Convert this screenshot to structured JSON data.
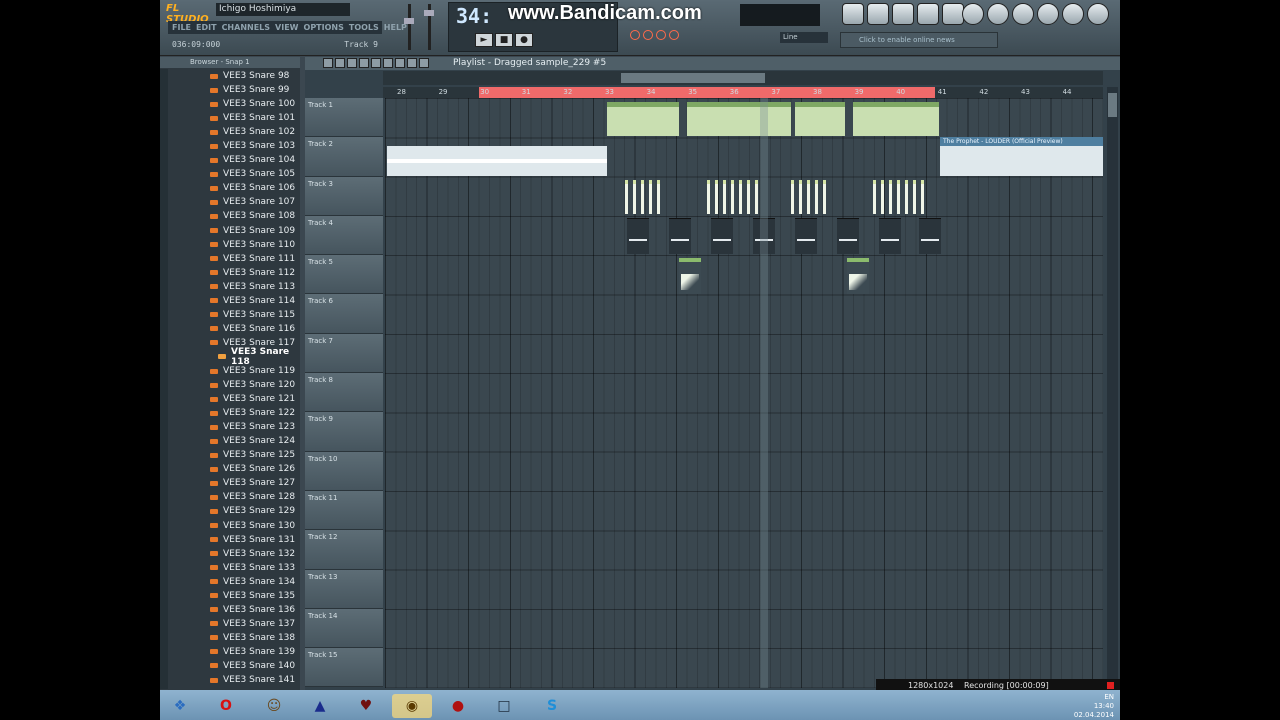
{
  "app": {
    "logo": "FL STUDIO",
    "song_title": "Ichigo Hoshimiya",
    "menus": [
      "FILE",
      "EDIT",
      "CHANNELS",
      "VIEW",
      "OPTIONS",
      "TOOLS",
      "HELP"
    ],
    "song_time": "036:09:000",
    "focus_label": "Track 9",
    "clock": "34:",
    "watermark": "www.Bandicam.com",
    "mode": "Line",
    "news": "Click to enable online news"
  },
  "browser": {
    "title": "Browser - Snap 1",
    "items": [
      "VEE3 Snare 98",
      "VEE3 Snare 99",
      "VEE3 Snare 100",
      "VEE3 Snare 101",
      "VEE3 Snare 102",
      "VEE3 Snare 103",
      "VEE3 Snare 104",
      "VEE3 Snare 105",
      "VEE3 Snare 106",
      "VEE3 Snare 107",
      "VEE3 Snare 108",
      "VEE3 Snare 109",
      "VEE3 Snare 110",
      "VEE3 Snare 111",
      "VEE3 Snare 112",
      "VEE3 Snare 113",
      "VEE3 Snare 114",
      "VEE3 Snare 115",
      "VEE3 Snare 116",
      "VEE3 Snare 117",
      "VEE3 Snare 118",
      "VEE3 Snare 119",
      "VEE3 Snare 120",
      "VEE3 Snare 121",
      "VEE3 Snare 122",
      "VEE3 Snare 123",
      "VEE3 Snare 124",
      "VEE3 Snare 125",
      "VEE3 Snare 126",
      "VEE3 Snare 127",
      "VEE3 Snare 128",
      "VEE3 Snare 129",
      "VEE3 Snare 130",
      "VEE3 Snare 131",
      "VEE3 Snare 132",
      "VEE3 Snare 133",
      "VEE3 Snare 134",
      "VEE3 Snare 135",
      "VEE3 Snare 136",
      "VEE3 Snare 137",
      "VEE3 Snare 138",
      "VEE3 Snare 139",
      "VEE3 Snare 140",
      "VEE3 Snare 141"
    ],
    "selected": "VEE3 Snare 118"
  },
  "playlist": {
    "title": "Playlist - Dragged sample_229 #5",
    "ruler": [
      "28",
      "29",
      "30",
      "31",
      "32",
      "33",
      "34",
      "35",
      "36",
      "37",
      "38",
      "39",
      "40",
      "41",
      "42",
      "43",
      "44"
    ],
    "tracks": [
      "Track 1",
      "Track 2",
      "Track 3",
      "Track 4",
      "Track 5",
      "Track 6",
      "Track 7",
      "Track 8",
      "Track 9",
      "Track 10",
      "Track 11",
      "Track 12",
      "Track 13",
      "Track 14",
      "Track 15"
    ],
    "prophet_clip": "The Prophet - LOUDER (Official Preview)"
  },
  "recorder": {
    "resolution": "1280x1024",
    "status": "Recording [00:00:09]"
  },
  "taskbar": {
    "lang": "EN",
    "time": "13:40",
    "date": "02.04.2014"
  }
}
